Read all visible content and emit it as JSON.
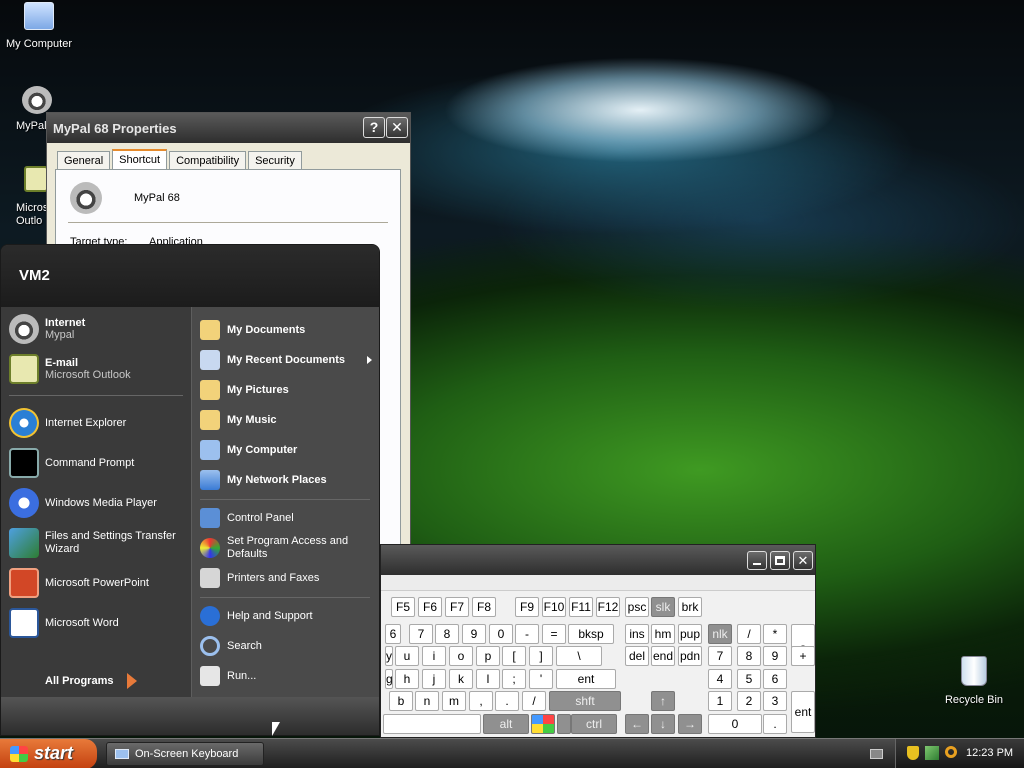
{
  "desktop": {
    "icons": [
      {
        "label": "My Computer",
        "icon": "computer-icon"
      },
      {
        "label": "MyPal",
        "icon": "mypal-shortcut-icon"
      },
      {
        "label": "Micros\nOutlo",
        "icon": "outlook-shortcut-icon"
      },
      {
        "label": "Recycle Bin",
        "icon": "recycle-bin-icon"
      }
    ]
  },
  "properties": {
    "title": "MyPal 68 Properties",
    "help_btn": "?",
    "close_btn": "✕",
    "tabs": [
      "General",
      "Shortcut",
      "Compatibility",
      "Security"
    ],
    "selected_tab": "Shortcut",
    "name": "MyPal 68",
    "target_type_label": "Target type:",
    "target_type_value": "Application"
  },
  "start_menu": {
    "user": "VM2",
    "pinned": [
      {
        "title": "Internet",
        "sub": "Mypal"
      },
      {
        "title": "E-mail",
        "sub": "Microsoft Outlook"
      }
    ],
    "recent": [
      "Internet Explorer",
      "Command Prompt",
      "Windows Media Player",
      "Files and Settings Transfer Wizard",
      "Microsoft PowerPoint",
      "Microsoft Word"
    ],
    "all_programs": "All Programs",
    "right_bold": [
      "My Documents",
      "My Recent Documents",
      "My Pictures",
      "My Music",
      "My Computer",
      "My Network Places"
    ],
    "right_plain": [
      "Control Panel",
      "Set Program Access and Defaults",
      "Printers and Faxes"
    ],
    "right_bottom": [
      "Help and Support",
      "Search",
      "Run..."
    ]
  },
  "keyboard": {
    "rows": [
      [
        "F5",
        "F6",
        "F7",
        "F8",
        "F9",
        "F10",
        "F11",
        "F12",
        "psc",
        "slk",
        "brk"
      ],
      [
        "6",
        "7",
        "8",
        "9",
        "0",
        "-",
        "=",
        "bksp",
        "ins",
        "hm",
        "pup",
        "nlk",
        "/",
        "*",
        "-"
      ],
      [
        "y",
        "u",
        "i",
        "o",
        "p",
        "[",
        "]",
        "\\",
        "del",
        "end",
        "pdn",
        "7",
        "8",
        "9",
        "+"
      ],
      [
        "g",
        "h",
        "j",
        "k",
        "l",
        ";",
        "'",
        "ent",
        "4",
        "5",
        "6"
      ],
      [
        "b",
        "n",
        "m",
        ",",
        ".",
        "/",
        "shft",
        "↑",
        "1",
        "2",
        "3",
        "ent"
      ],
      [
        "alt",
        "ctrl",
        "←",
        "↓",
        "→",
        "0",
        "."
      ]
    ]
  },
  "taskbar": {
    "start": "start",
    "task": "On-Screen Keyboard",
    "clock": "12:23 PM"
  },
  "colors": {
    "start_button": "#d95a1f",
    "titlebar": "#3a3a3a"
  }
}
